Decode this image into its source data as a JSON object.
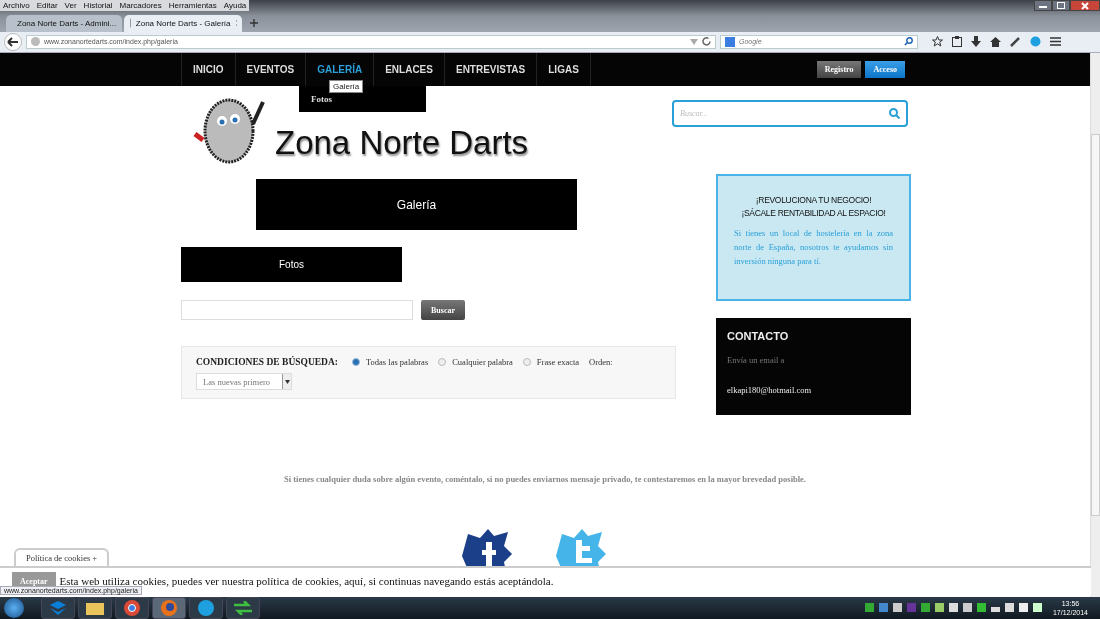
{
  "menu_bar": [
    "Archivo",
    "Editar",
    "Ver",
    "Historial",
    "Marcadores",
    "Herramientas",
    "Ayuda"
  ],
  "tabs": [
    {
      "title": "Zona Norte Darts - Admini...",
      "selected": false
    },
    {
      "title": "Zona Norte Darts - Galería",
      "selected": true
    }
  ],
  "address_bar": {
    "url": "www.zonanortedarts.com/index.php/galeria"
  },
  "web_search": {
    "placeholder": "Google"
  },
  "site_nav": {
    "items": [
      {
        "label": "INICIO",
        "selected": false
      },
      {
        "label": "EVENTOS",
        "selected": false
      },
      {
        "label": "GALERÍA",
        "selected": true
      },
      {
        "label": "ENLACES",
        "selected": false
      },
      {
        "label": "ENTREVISTAS",
        "selected": false
      },
      {
        "label": "LIGAS",
        "selected": false
      }
    ],
    "tooltip": "Galería",
    "dropdown": [
      "Fotos"
    ],
    "buttons": [
      {
        "label": "Registro",
        "kind": "secondary"
      },
      {
        "label": "Acceso",
        "kind": "primary"
      }
    ]
  },
  "site_search": {
    "placeholder": "Buscar..."
  },
  "logo": {
    "text": "Zona Norte Darts"
  },
  "page_title": "Galería",
  "category": "Fotos",
  "search_form": {
    "button": "Buscar"
  },
  "conditions": {
    "label": "CONDICIONES DE BÚSQUEDA:",
    "options": [
      {
        "label": "Todas las palabras",
        "selected": true
      },
      {
        "label": "Cualquier palabra",
        "selected": false
      },
      {
        "label": "Frase exacta",
        "selected": false
      }
    ],
    "order_label": "Orden:",
    "order_value": "Las nuevas primero"
  },
  "promo": {
    "title_lines": [
      "¡REVOLUCIONA TU NEGOCIO!",
      "¡SÁCALE RENTABILIDAD AL ESPACIO!"
    ],
    "text": "Si tienes un local de hostelería en la zona norte de España, nosotros te ayudamos sin inversión ninguna para tí."
  },
  "contact": {
    "heading": "CONTACTO",
    "text": "Envía un email a",
    "email": "elkapi180@hotmail.com"
  },
  "footer_note": "Si tienes cualquier duda sobre algún evento, coméntalo, si no puedes enviarnos mensaje privado, te contestaremos en la mayor brevedad posible.",
  "cookies": {
    "tab": "Política de cookies +",
    "button": "Aceptar",
    "text": "Esta web utiliza cookies, puedes ver nuestra política de cookies, aquí, si continuas navegando estás aceptándola."
  },
  "status_url": "www.zonanortedarts.com/index.php/galeria",
  "taskbar": {
    "time": "13:56",
    "date": "17/12/2014"
  }
}
